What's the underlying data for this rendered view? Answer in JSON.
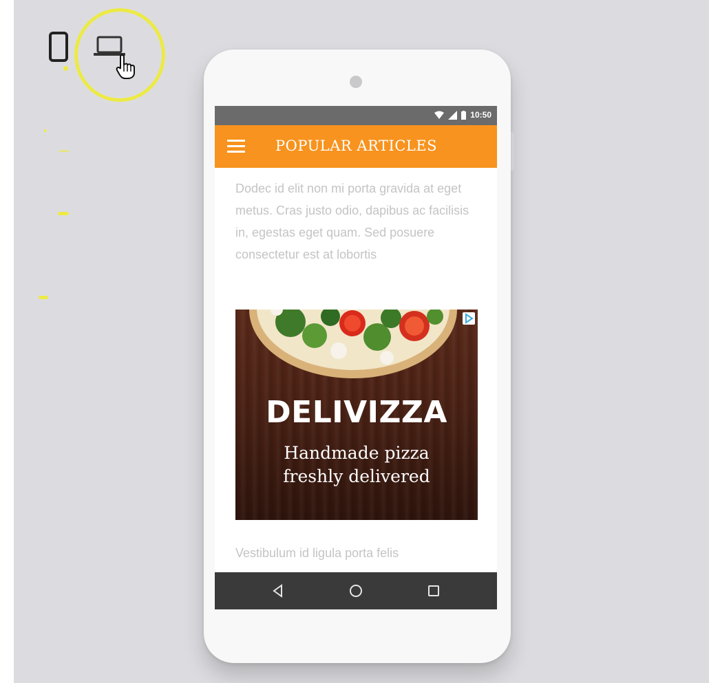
{
  "statusbar": {
    "time": "10:50"
  },
  "appbar": {
    "title": "POPULAR ARTICLES"
  },
  "article": {
    "paragraph_1": "Dodec id elit non mi porta gravida at eget metus. Cras justo odio, dapibus ac facilisis in, egestas eget quam. Sed posuere consectetur est at lobortis",
    "paragraph_2": "Vestibulum id ligula porta felis"
  },
  "ad": {
    "brand": "DELIVIZZA",
    "tagline_line_1": "Handmade pizza",
    "tagline_line_2": "freshly delivered"
  },
  "colors": {
    "accent_orange": "#f7931e",
    "highlight_yellow": "#ecea45",
    "background": "#dcdce0",
    "navbar": "#3a3a3a"
  },
  "icons": {
    "phone_toggle": "phone-icon",
    "laptop_toggle": "laptop-icon",
    "cursor": "hand-cursor-icon",
    "menu": "hamburger-menu-icon",
    "back": "back-triangle-icon",
    "home": "home-circle-icon",
    "recents": "recents-square-icon"
  }
}
